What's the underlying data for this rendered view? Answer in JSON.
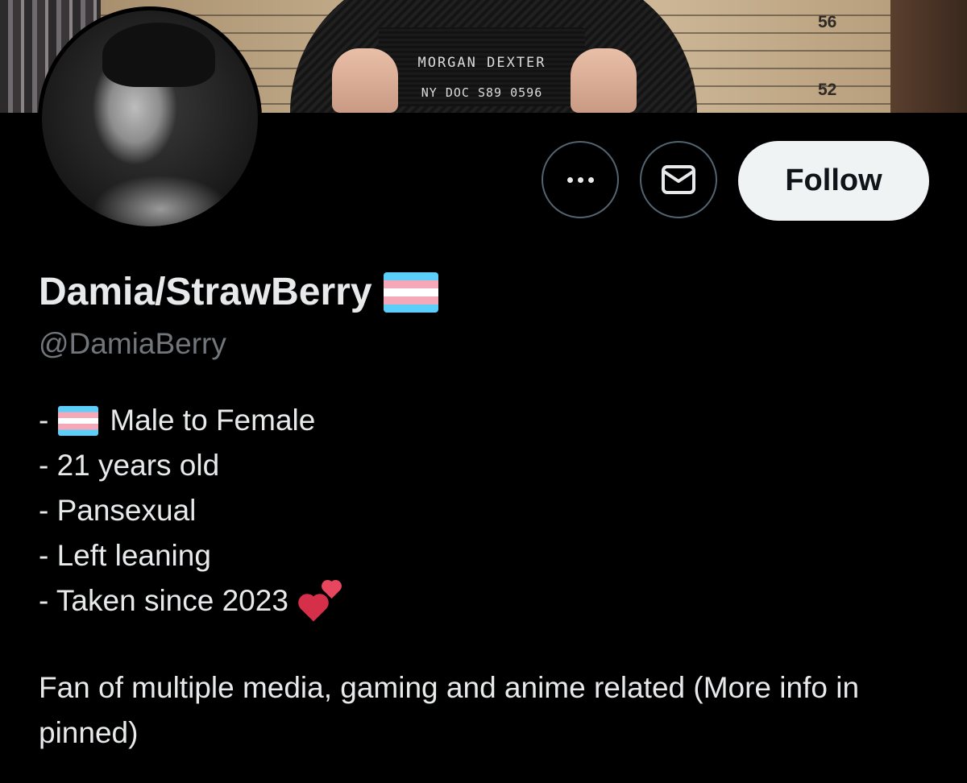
{
  "banner": {
    "height_marks": [
      "56",
      "52"
    ],
    "board_name": "MORGAN DEXTER",
    "board_id": "NY DOC S89 0596"
  },
  "actions": {
    "more_icon": "more-horizontal-icon",
    "message_icon": "envelope-icon",
    "follow_label": "Follow"
  },
  "profile": {
    "display_name": "Damia/StrawBerry",
    "name_badge_icon": "transgender-flag-icon",
    "handle": "@DamiaBerry"
  },
  "bio": {
    "prefix": "-",
    "line1": "Male to Female",
    "line2": "- 21 years old",
    "line3": "- Pansexual",
    "line4": "- Left leaning",
    "line5": "- Taken since 2023",
    "line5_icon": "two-hearts-icon",
    "description": "Fan of multiple media, gaming and anime related (More info in pinned)"
  },
  "colors": {
    "background": "#000000",
    "text": "#e7e9ea",
    "muted": "#71767b",
    "button_border": "#536471",
    "follow_bg": "#eff3f4",
    "flag_blue": "#5bcefa",
    "flag_pink": "#f5a9b8"
  }
}
